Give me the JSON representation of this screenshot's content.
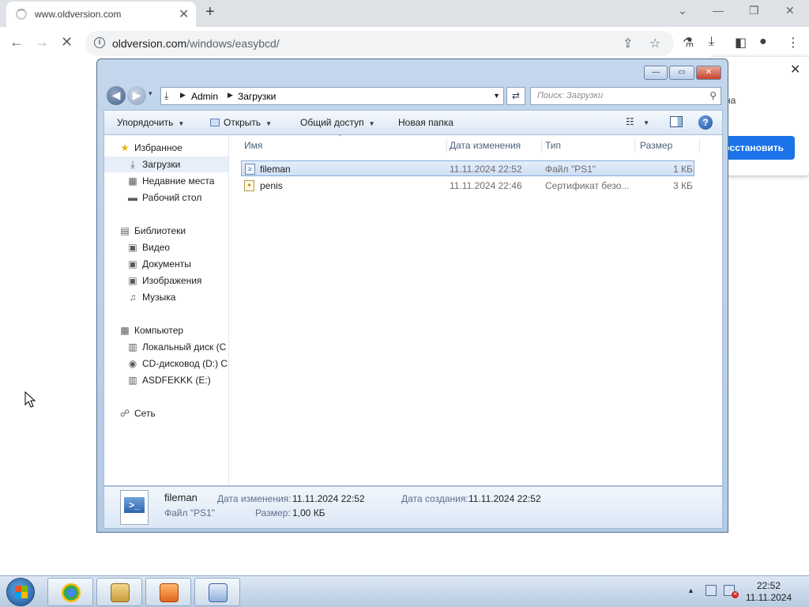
{
  "browser": {
    "tab_title": "www.oldversion.com",
    "tab_close": "✕",
    "new_tab": "+",
    "window_controls": [
      "⌄",
      "—",
      "❐",
      "✕"
    ],
    "url_domain": "oldversion.com",
    "url_path": "/windows/easybcd/",
    "popup_text": "на",
    "popup_button": "осстановить",
    "popup_close": "✕"
  },
  "explorer": {
    "title_buttons": [
      "—",
      "▭",
      "✕"
    ],
    "breadcrumb": [
      "Admin",
      "Загрузки"
    ],
    "search_placeholder": "Поиск: Загрузки",
    "toolbar": {
      "organize": "Упорядочить",
      "open": "Открыть",
      "share": "Общий доступ",
      "new_folder": "Новая папка"
    },
    "nav": {
      "favorites": "Избранное",
      "favorites_items": [
        "Загрузки",
        "Недавние места",
        "Рабочий стол"
      ],
      "libraries": "Библиотеки",
      "libraries_items": [
        "Видео",
        "Документы",
        "Изображения",
        "Музыка"
      ],
      "computer": "Компьютер",
      "computer_items": [
        "Локальный диск (C",
        "CD-дисковод (D:) C",
        "ASDFEKKK (E:)"
      ],
      "network": "Сеть"
    },
    "columns": {
      "name": "Имя",
      "modified": "Дата изменения",
      "type": "Тип",
      "size": "Размер"
    },
    "files": [
      {
        "name": "fileman",
        "modified": "11.11.2024 22:52",
        "type": "Файл \"PS1\"",
        "size": "1 КБ"
      },
      {
        "name": "penis",
        "modified": "11.11.2024 22:46",
        "type": "Сертификат безо...",
        "size": "3 КБ"
      }
    ],
    "details": {
      "name": "fileman",
      "type": "Файл \"PS1\"",
      "modified_label": "Дата изменения:",
      "modified_value": "11.11.2024 22:52",
      "created_label": "Дата создания:",
      "created_value": "11.11.2024 22:52",
      "size_label": "Размер:",
      "size_value": "1,00 КБ"
    }
  },
  "taskbar": {
    "time": "22:52",
    "date": "11.11.2024"
  }
}
